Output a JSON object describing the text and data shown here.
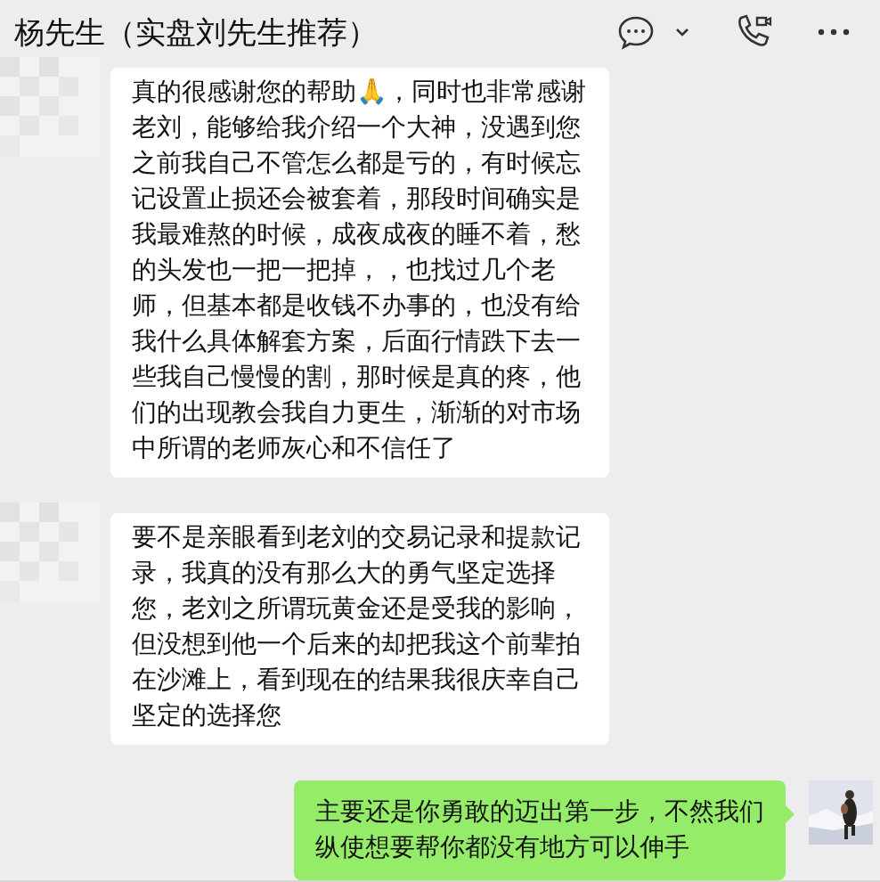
{
  "header": {
    "title": "杨先生（实盘刘先生推荐）"
  },
  "messages": [
    {
      "kind": "received",
      "text": "真的很感谢您的帮助🙏，同时也非常感谢老刘，能够给我介绍一个大神，没遇到您之前我自己不管怎么都是亏的，有时候忘记设置止损还会被套着，那段时间确实是我最难熬的时候，成夜成夜的睡不着，愁的头发也一把一把掉，，也找过几个老师，但基本都是收钱不办事的，也没有给我什么具体解套方案，后面行情跌下去一些我自己慢慢的割，那时候是真的疼，他们的出现教会我自力更生，渐渐的对市场中所谓的老师灰心和不信任了"
    },
    {
      "kind": "received",
      "text": "要不是亲眼看到老刘的交易记录和提款记录，我真的没有那么大的勇气坚定选择您，老刘之所谓玩黄金还是受我的影响，但没想到他一个后来的却把我这个前辈拍在沙滩上，看到现在的结果我很庆幸自己坚定的选择您"
    },
    {
      "kind": "sent",
      "text": "主要还是你勇敢的迈出第一步，不然我们纵使想要帮你都没有地方可以伸手"
    }
  ]
}
